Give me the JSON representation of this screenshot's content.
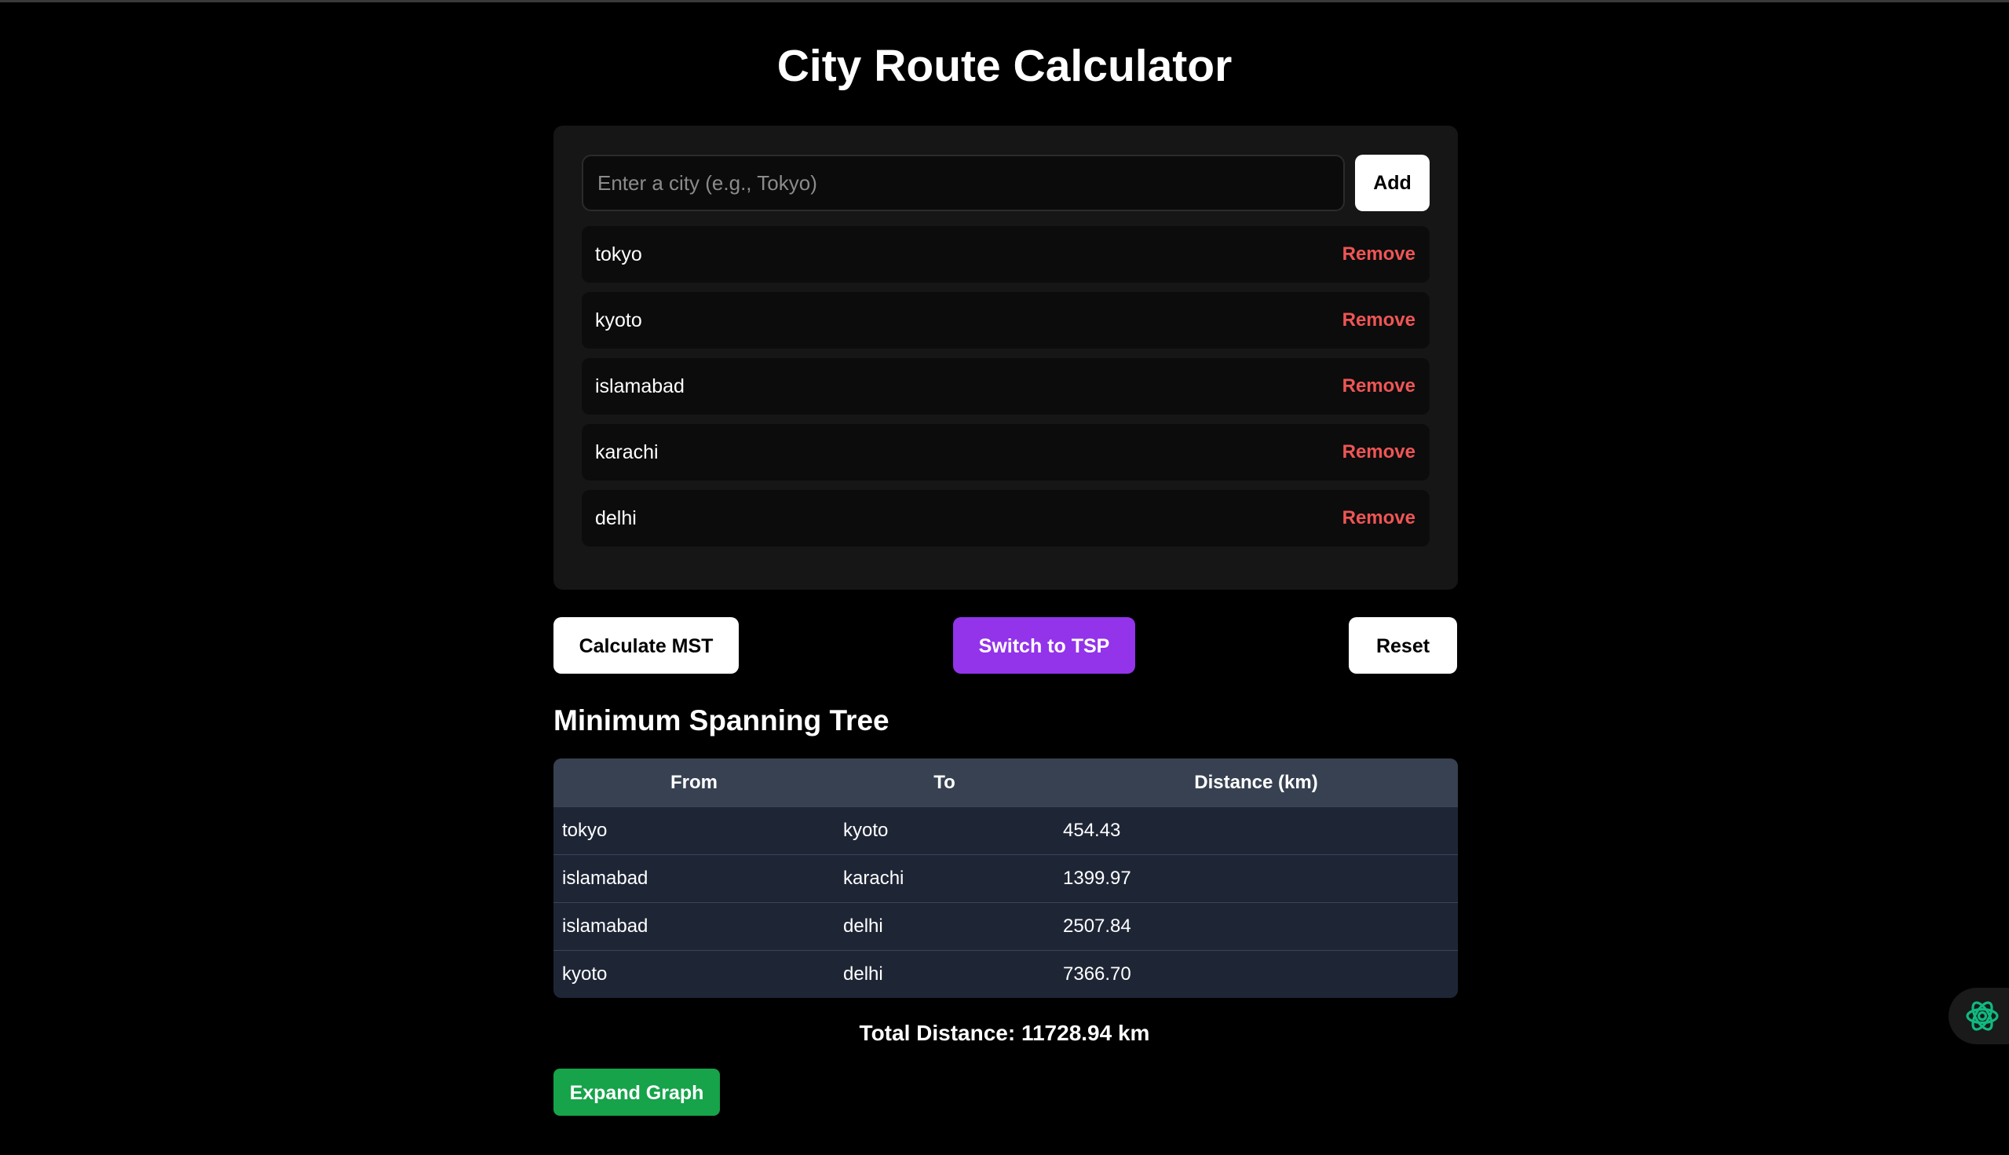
{
  "app": {
    "title": "City Route Calculator"
  },
  "input": {
    "placeholder": "Enter a city (e.g., Tokyo)",
    "value": "",
    "add_label": "Add"
  },
  "cities": [
    {
      "name": "tokyo",
      "remove_label": "Remove"
    },
    {
      "name": "kyoto",
      "remove_label": "Remove"
    },
    {
      "name": "islamabad",
      "remove_label": "Remove"
    },
    {
      "name": "karachi",
      "remove_label": "Remove"
    },
    {
      "name": "delhi",
      "remove_label": "Remove"
    }
  ],
  "actions": {
    "calculate_label": "Calculate MST",
    "switch_label": "Switch to TSP",
    "reset_label": "Reset"
  },
  "result": {
    "heading": "Minimum Spanning Tree",
    "columns": [
      "From",
      "To",
      "Distance (km)"
    ],
    "rows": [
      {
        "from": "tokyo",
        "to": "kyoto",
        "distance": "454.43"
      },
      {
        "from": "islamabad",
        "to": "karachi",
        "distance": "1399.97"
      },
      {
        "from": "islamabad",
        "to": "delhi",
        "distance": "2507.84"
      },
      {
        "from": "kyoto",
        "to": "delhi",
        "distance": "7366.70"
      }
    ],
    "total": "Total Distance: 11728.94 km",
    "expand_label": "Expand Graph"
  },
  "widget": {
    "icon": "openai-assistant-icon"
  },
  "colors": {
    "background": "#000000",
    "panel": "#161616",
    "remove": "#ef5555",
    "switch_button": "#9333ea",
    "expand_button": "#16a34a",
    "table_header": "#374151",
    "table_body": "#1e2636",
    "widget_icon": "#10b981"
  }
}
